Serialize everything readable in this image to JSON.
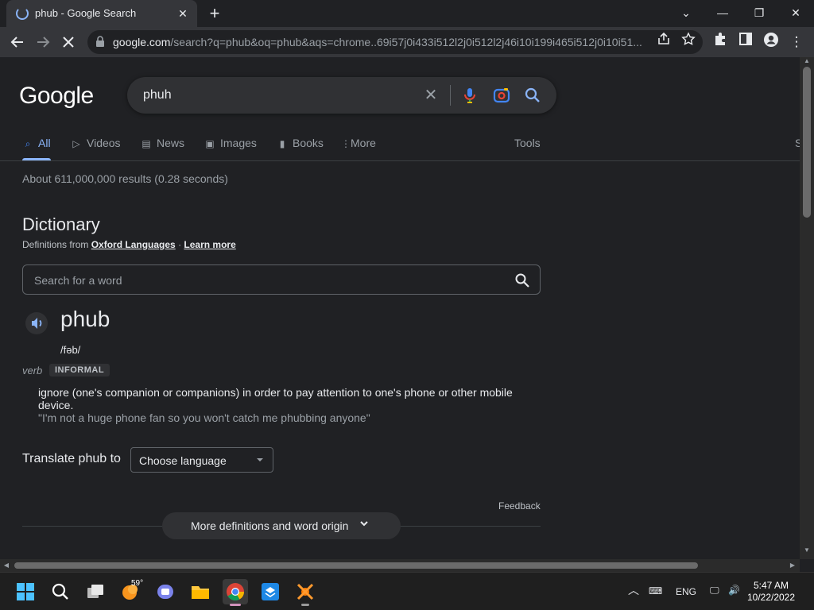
{
  "browser": {
    "tab_title": "phub - Google Search",
    "url_host": "google.com",
    "url_rest": "/search?q=phub&oq=phub&aqs=chrome..69i57j0i433i512l2j0i512l2j46i10i199i465i512j0i10i51..."
  },
  "google": {
    "logo_text": "Google",
    "query": "phuh",
    "tabs": [
      {
        "label": "All",
        "icon": "search-icon"
      },
      {
        "label": "Videos",
        "icon": "video-icon"
      },
      {
        "label": "News",
        "icon": "news-icon"
      },
      {
        "label": "Images",
        "icon": "image-icon"
      },
      {
        "label": "Books",
        "icon": "book-icon"
      },
      {
        "label": "More",
        "icon": "more-vert-icon"
      }
    ],
    "tools_label": "Tools",
    "edge_label": "S",
    "result_stats": "About 611,000,000 results (0.28 seconds)"
  },
  "dictionary": {
    "heading": "Dictionary",
    "source_prefix": "Definitions from",
    "source_link": "Oxford Languages",
    "separator": "·",
    "learn_more": "Learn more",
    "search_placeholder": "Search for a word",
    "word": "phub",
    "phonetic": "/fəb/",
    "part_of_speech": "verb",
    "register_badge": "INFORMAL",
    "definition": "ignore (one's companion or companions) in order to pay attention to one's phone or other mobile device.",
    "example": "\"I'm not a huge phone fan so you won't catch me phubbing anyone\"",
    "translate_label": "Translate phub to",
    "translate_select": "Choose language",
    "feedback": "Feedback",
    "more_button": "More definitions and word origin"
  },
  "taskbar": {
    "weather_temp": "59°",
    "lang": "ENG",
    "time": "5:47 AM",
    "date": "10/22/2022"
  },
  "colors": {
    "page_bg": "#202124",
    "link_blue": "#8ab4f8",
    "text_primary": "#e8eaed",
    "text_secondary": "#9aa0a6"
  }
}
